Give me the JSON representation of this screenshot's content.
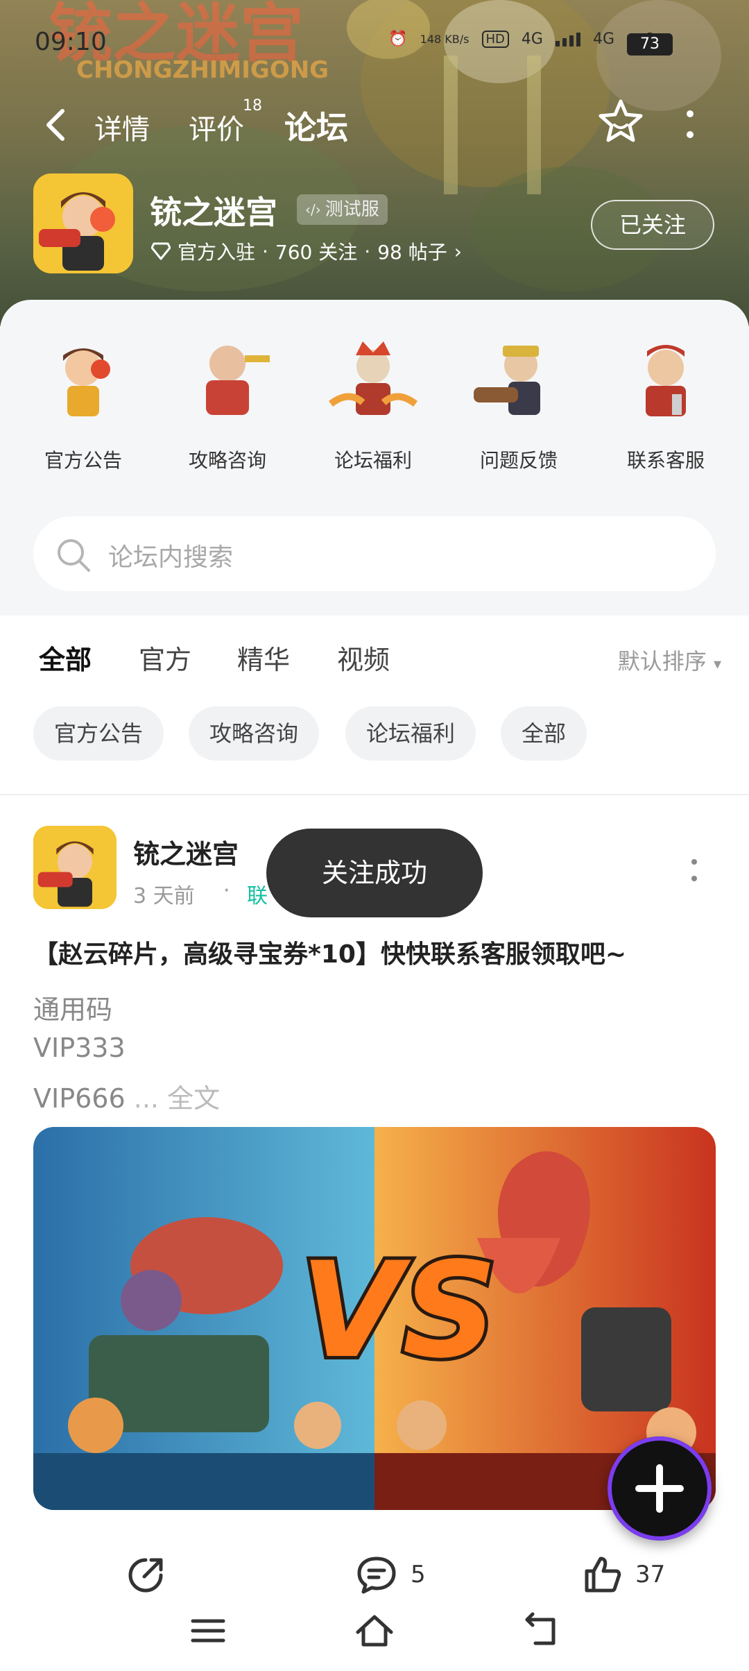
{
  "status_bar": {
    "time": "09:10",
    "net_speed": "148 KB/s",
    "hd_label": "HD",
    "net1": "4G",
    "net2": "4G",
    "battery": "73"
  },
  "nav": {
    "tabs": [
      {
        "label": "详情"
      },
      {
        "label": "评价",
        "badge": "18"
      },
      {
        "label": "论坛"
      }
    ]
  },
  "app": {
    "name": "铳之迷宫",
    "badge": "测试服",
    "verified": "官方入驻",
    "follows": "760 关注",
    "posts": "98 帖子",
    "follow_button": "已关注"
  },
  "quick_links": [
    {
      "label": "官方公告"
    },
    {
      "label": "攻略咨询"
    },
    {
      "label": "论坛福利"
    },
    {
      "label": "问题反馈"
    },
    {
      "label": "联系客服"
    }
  ],
  "search": {
    "placeholder": "论坛内搜索"
  },
  "category_tabs": [
    {
      "label": "全部"
    },
    {
      "label": "官方"
    },
    {
      "label": "精华"
    },
    {
      "label": "视频"
    }
  ],
  "sort": {
    "label": "默认排序"
  },
  "chips": [
    {
      "label": "官方公告"
    },
    {
      "label": "攻略咨询"
    },
    {
      "label": "论坛福利"
    },
    {
      "label": "全部"
    }
  ],
  "post": {
    "author": "铳之迷宫",
    "time": "3 天前",
    "dot": "·",
    "tag": "联",
    "title": "【赵云碎片，高级寻宝券*10】快快联系客服领取吧~",
    "lines": [
      "通用码",
      "VIP333",
      "VIP666"
    ],
    "ellipsis": " ... ",
    "full_text": "全文",
    "comments": "5",
    "likes": "37"
  },
  "toast": "关注成功",
  "colors": {
    "accent": "#12d3b0"
  }
}
